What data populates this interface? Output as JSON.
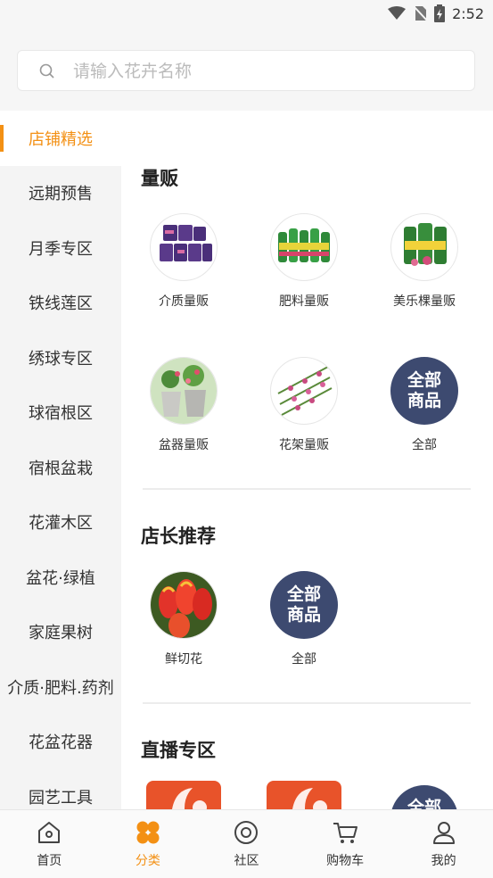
{
  "status": {
    "time": "2:52"
  },
  "search": {
    "placeholder": "请输入花卉名称"
  },
  "sidebar": {
    "items": [
      {
        "label": "店铺精选",
        "active": true
      },
      {
        "label": "远期预售"
      },
      {
        "label": "月季专区"
      },
      {
        "label": "铁线莲区"
      },
      {
        "label": "绣球专区"
      },
      {
        "label": "球宿根区"
      },
      {
        "label": "宿根盆栽"
      },
      {
        "label": "花灌木区"
      },
      {
        "label": "盆花·绿植"
      },
      {
        "label": "家庭果树"
      },
      {
        "label": "介质·肥料.药剂"
      },
      {
        "label": "花盆花器"
      },
      {
        "label": "园艺工具"
      }
    ]
  },
  "sections": {
    "bulk": {
      "title": "量贩",
      "items": [
        "介质量贩",
        "肥料量贩",
        "美乐棵量贩",
        "盆器量贩",
        "花架量贩",
        "全部"
      ]
    },
    "manager": {
      "title": "店长推荐",
      "items": [
        "鲜切花",
        "全部"
      ]
    },
    "live": {
      "title": "直播专区"
    },
    "all_badge": [
      "全部",
      "商品"
    ]
  },
  "tabbar": {
    "items": [
      {
        "label": "首页",
        "icon": "home-icon"
      },
      {
        "label": "分类",
        "icon": "category-icon",
        "active": true
      },
      {
        "label": "社区",
        "icon": "community-icon"
      },
      {
        "label": "购物车",
        "icon": "cart-icon"
      },
      {
        "label": "我的",
        "icon": "profile-icon"
      }
    ]
  },
  "colors": {
    "accent": "#f39014",
    "badge": "#3d4a70",
    "live": "#e8532a"
  }
}
